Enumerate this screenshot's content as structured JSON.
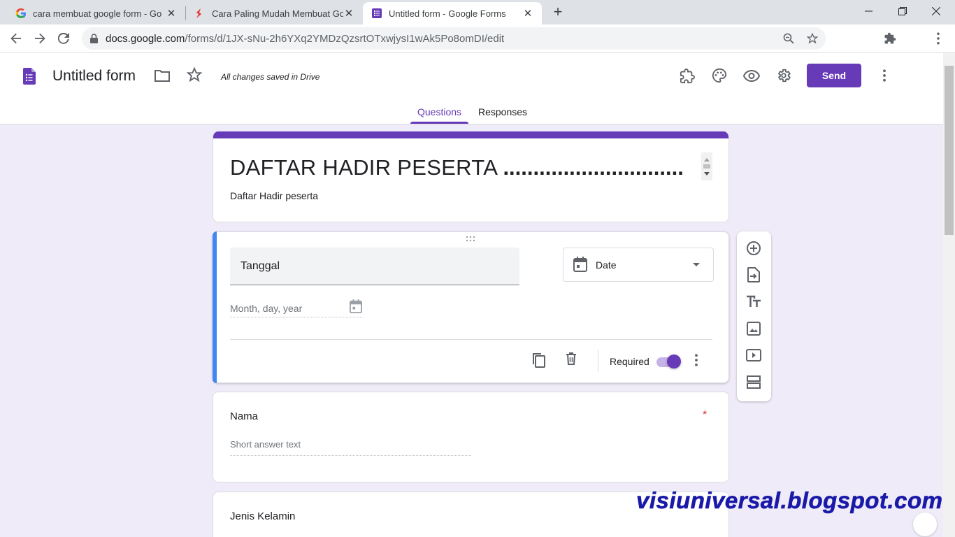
{
  "browser": {
    "tabs": [
      {
        "title": "cara membuat google form - Go",
        "favicon": "google-g-icon"
      },
      {
        "title": "Cara Paling Mudah Membuat Go",
        "favicon": "red-s-icon"
      },
      {
        "title": "Untitled form - Google Forms",
        "favicon": "google-forms-icon",
        "active": true
      }
    ],
    "url_host": "docs.google.com",
    "url_path": "/forms/d/1JX-sNu-2h6YXq2YMDzQzsrtOTxwjysI1wAk5Po8omDI/edit"
  },
  "header": {
    "form_name": "Untitled form",
    "saved_status": "All changes saved in Drive",
    "send_label": "Send",
    "tabs": {
      "questions": "Questions",
      "responses": "Responses"
    }
  },
  "form": {
    "title": "DAFTAR HADIR PESERTA",
    "title_dots": "..............................",
    "description": "Daftar Hadir peserta",
    "questions": [
      {
        "title": "Tanggal",
        "type": "Date",
        "placeholder": "Month, day, year",
        "required_label": "Required",
        "required": true
      },
      {
        "title": "Nama",
        "required_mark": "*",
        "answer_placeholder": "Short answer text"
      },
      {
        "title": "Jenis Kelamin"
      }
    ]
  },
  "watermark": "visiuniversal.blogspot.com",
  "colors": {
    "primary": "#673ab7",
    "background": "#f0ebf8",
    "active_question": "#4285f4",
    "required_star": "#d93025"
  }
}
